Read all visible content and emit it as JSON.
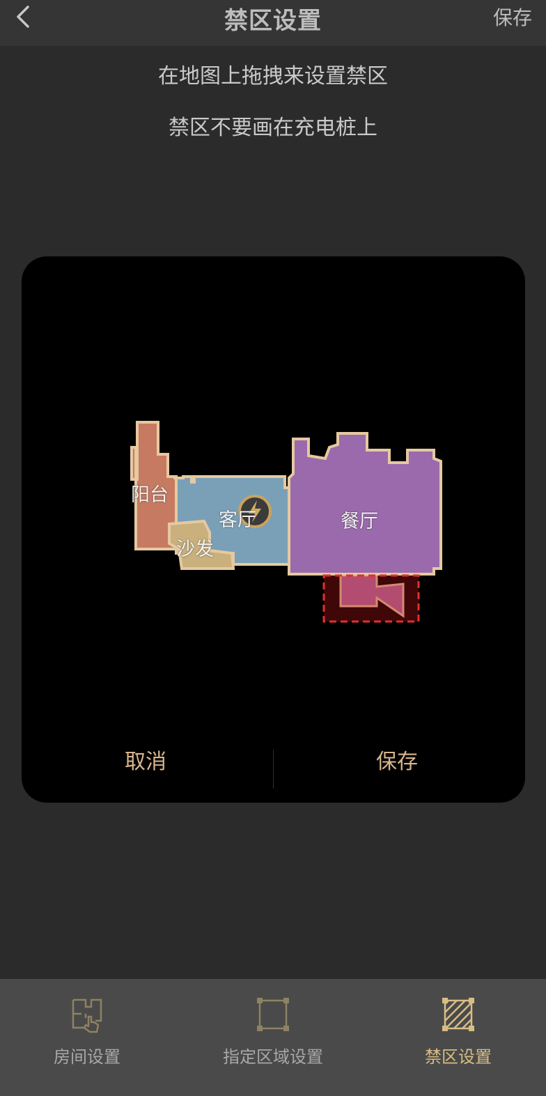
{
  "header": {
    "title": "禁区设置",
    "save_label": "保存",
    "back_icon": "chevron-left-icon"
  },
  "hints": [
    "在地图上拖拽来设置禁区",
    "禁区不要画在充电桩上"
  ],
  "map": {
    "rooms": [
      {
        "name": "阳台",
        "color": "#c77a62"
      },
      {
        "name": "客厅",
        "color": "#7aa0b8"
      },
      {
        "name": "沙发",
        "color": "#c9b07c"
      },
      {
        "name": "餐厅",
        "color": "#9a6aad"
      }
    ],
    "charger_icon": "lightning-icon",
    "border_color": "#e5c9a0",
    "no_go_zone_color": "#e0302f",
    "cancel_label": "取消",
    "save_label": "保存"
  },
  "tabs": [
    {
      "label": "房间设置",
      "icon": "room-settings-icon",
      "active": false
    },
    {
      "label": "指定区域设置",
      "icon": "area-settings-icon",
      "active": false
    },
    {
      "label": "禁区设置",
      "icon": "no-go-zone-icon",
      "active": true
    }
  ],
  "colors": {
    "accent": "#d8bd85",
    "background": "#2b2b2b",
    "header": "#353535",
    "tabbar": "#4a4a4a"
  }
}
